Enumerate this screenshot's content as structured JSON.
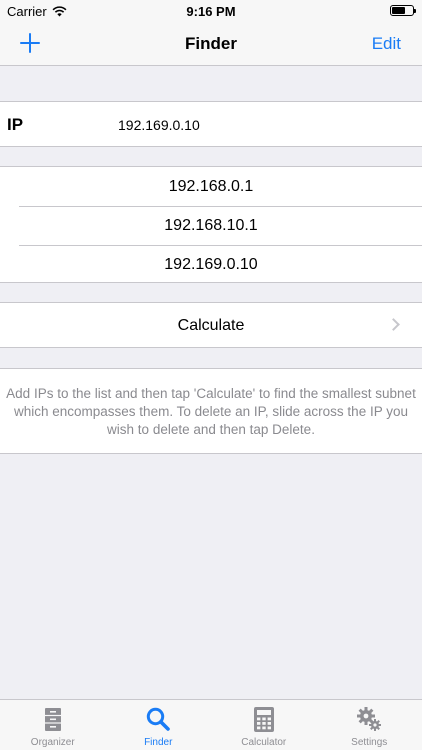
{
  "status_bar": {
    "carrier": "Carrier",
    "time": "9:16 PM"
  },
  "nav": {
    "title": "Finder",
    "edit_label": "Edit"
  },
  "ip_field": {
    "label": "IP",
    "value": "192.169.0.10"
  },
  "ip_list": [
    "192.168.0.1",
    "192.168.10.1",
    "192.169.0.10"
  ],
  "calculate": {
    "label": "Calculate"
  },
  "info": {
    "text": "Add IPs to the list and then tap 'Calculate' to find the smallest subnet which encompasses them. To delete an IP, slide across the IP you wish to delete and then tap Delete."
  },
  "tabs": [
    {
      "label": "Organizer",
      "icon": "organizer-icon",
      "active": false
    },
    {
      "label": "Finder",
      "icon": "search-icon",
      "active": true
    },
    {
      "label": "Calculator",
      "icon": "calculator-icon",
      "active": false
    },
    {
      "label": "Settings",
      "icon": "gear-icon",
      "active": false
    }
  ],
  "colors": {
    "accent": "#1a7cf5",
    "inactive": "#8e8e93",
    "background": "#efeff4"
  }
}
